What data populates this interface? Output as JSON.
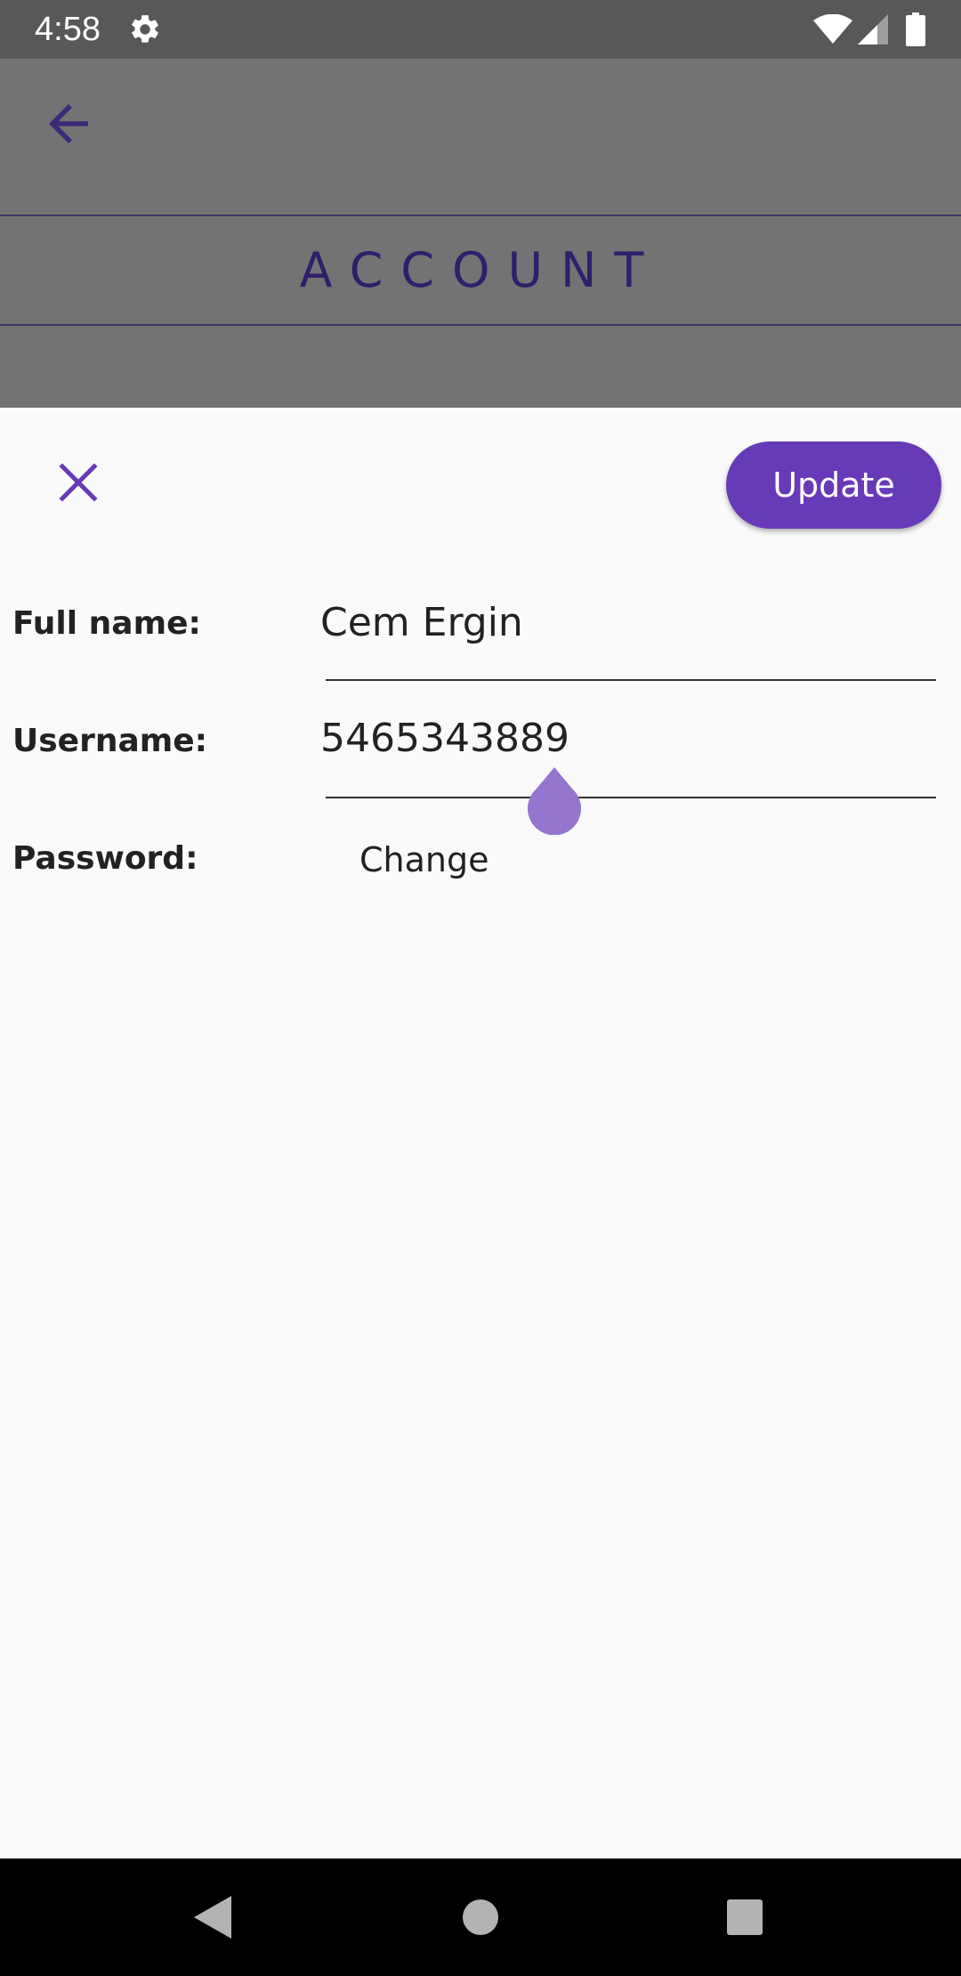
{
  "status_bar": {
    "time": "4:58",
    "icons": [
      "settings-gear-icon",
      "wifi-icon",
      "cell-signal-icon",
      "battery-icon"
    ]
  },
  "background_page": {
    "title": "ACCOUNT",
    "back_icon": "arrow-back-icon"
  },
  "sheet": {
    "close_icon": "close-icon",
    "update_label": "Update",
    "fields": {
      "full_name": {
        "label": "Full name:",
        "value": "Cem Ergin"
      },
      "username": {
        "label": "Username:",
        "value": "5465343889"
      },
      "password": {
        "label": "Password:",
        "action": "Change"
      }
    }
  },
  "navigation_bar": {
    "icons": [
      "nav-back-icon",
      "nav-home-icon",
      "nav-recents-icon"
    ]
  },
  "colors": {
    "accent": "#673ab7",
    "cursor_handle": "#9575cd",
    "scrim_gray": "#737373",
    "title_purple": "#2f1f6b",
    "status_bar": "#585858",
    "sheet_background": "#fafafa"
  }
}
